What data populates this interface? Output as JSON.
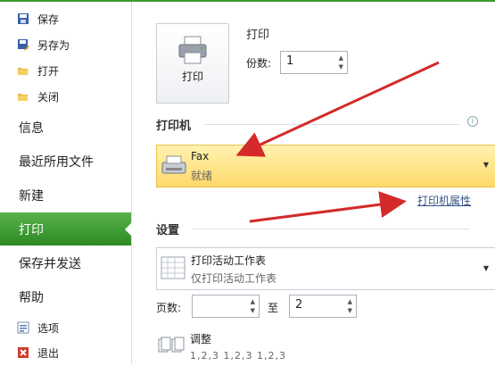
{
  "sidebar": {
    "small_top": [
      {
        "label": "保存",
        "icon": "save-icon"
      },
      {
        "label": "另存为",
        "icon": "save-as-icon"
      },
      {
        "label": "打开",
        "icon": "open-folder-icon"
      },
      {
        "label": "关闭",
        "icon": "close-folder-icon"
      }
    ],
    "big": [
      {
        "label": "信息"
      },
      {
        "label": "最近所用文件"
      },
      {
        "label": "新建"
      },
      {
        "label": "打印"
      },
      {
        "label": "保存并发送"
      },
      {
        "label": "帮助"
      }
    ],
    "small_bottom": [
      {
        "label": "选项",
        "icon": "options-icon"
      },
      {
        "label": "退出",
        "icon": "exit-icon"
      }
    ]
  },
  "print_section": {
    "title": "打印",
    "print_button_label": "打印",
    "copies_label": "份数:",
    "copies_value": "1"
  },
  "printer_section": {
    "title": "打印机",
    "printer_name": "Fax",
    "printer_status": "就绪",
    "properties_link": "打印机属性"
  },
  "settings_section": {
    "title": "设置",
    "scope_title": "打印活动工作表",
    "scope_desc": "仅打印活动工作表",
    "pages_label": "页数:",
    "pages_from": "",
    "to_label": "至",
    "pages_to": "2",
    "collate_title": "调整",
    "collate_desc": "1,2,3    1,2,3    1,2,3"
  },
  "colors": {
    "accent_green": "#3f9a34",
    "printer_highlight": "#ffd96b",
    "arrow_red": "#d42a2a"
  }
}
